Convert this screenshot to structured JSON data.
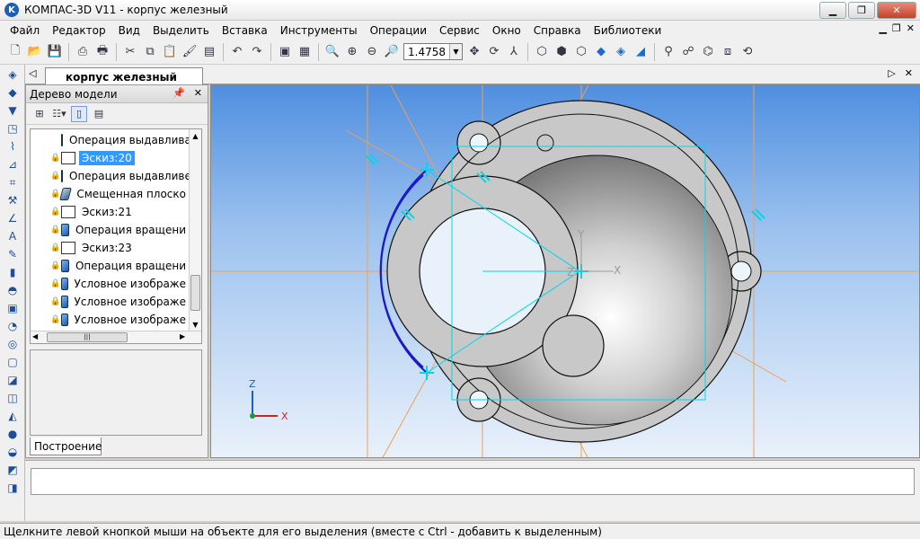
{
  "titlebar": {
    "app_title": "КОМПАС-3D V11 - корпус железный",
    "logo_letter": "K"
  },
  "menubar": {
    "items": [
      "Файл",
      "Редактор",
      "Вид",
      "Выделить",
      "Вставка",
      "Инструменты",
      "Операции",
      "Сервис",
      "Окно",
      "Справка",
      "Библиотеки"
    ]
  },
  "toolbar": {
    "zoom_value": "1.4758"
  },
  "document": {
    "tab_title": "корпус железный"
  },
  "tree": {
    "header": "Дерево модели",
    "items": [
      {
        "label": "Операция выдавлива",
        "icon": "extrude-icon",
        "selected": false
      },
      {
        "label": "Эскиз:20",
        "icon": "sketch-icon",
        "selected": true
      },
      {
        "label": "Операция выдавливе",
        "icon": "extrude-icon",
        "selected": false
      },
      {
        "label": "Смещенная плоско",
        "icon": "plane-icon",
        "selected": false
      },
      {
        "label": "Эскиз:21",
        "icon": "sketch-icon",
        "selected": false
      },
      {
        "label": "Операция вращени",
        "icon": "revolve-icon",
        "selected": false
      },
      {
        "label": "Эскиз:23",
        "icon": "sketch-icon",
        "selected": false
      },
      {
        "label": "Операция вращени",
        "icon": "revolve-icon",
        "selected": false
      },
      {
        "label": "Условное изображе",
        "icon": "thread-icon",
        "selected": false
      },
      {
        "label": "Условное изображе",
        "icon": "thread-icon",
        "selected": false
      },
      {
        "label": "Условное изображе",
        "icon": "thread-icon",
        "selected": false
      }
    ],
    "bottom_tab": "Построение"
  },
  "viewport": {
    "axis_x": "X",
    "axis_y": "Y",
    "axis_z": "Z",
    "triad_x": "X",
    "triad_z": "Z",
    "colors": {
      "body": "#c8c8c8",
      "construction": "#f0a050",
      "sketch": "#00d8e8",
      "selection": "#1a1acc"
    }
  },
  "statusbar": {
    "text": "Щелкните левой кнопкой мыши на объекте для его выделения (вместе с Ctrl - добавить к выделенным)"
  }
}
